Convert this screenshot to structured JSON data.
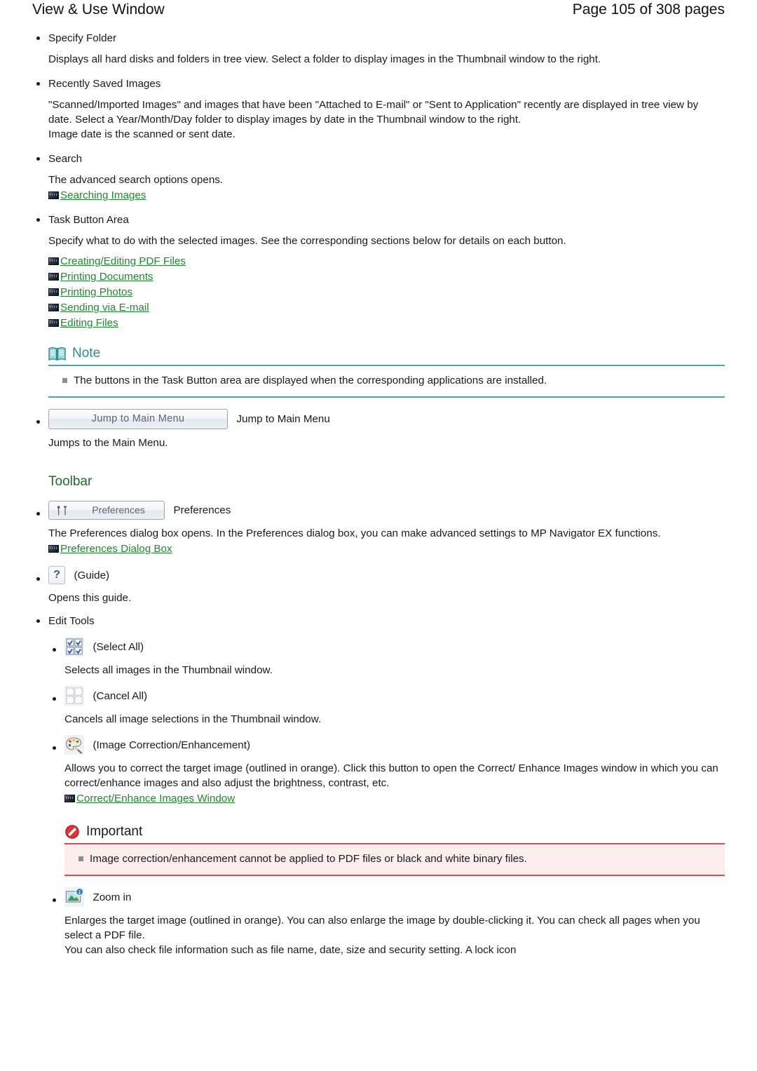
{
  "header": {
    "title": "View & Use Window",
    "page_count": "Page 105 of 308 pages"
  },
  "sections": {
    "specify_folder": {
      "label": "Specify Folder",
      "body": "Displays all hard disks and folders in tree view. Select a folder to display images in the Thumbnail window to the right."
    },
    "recently_saved": {
      "label": "Recently Saved Images",
      "body": "\"Scanned/Imported Images\" and images that have been \"Attached to E-mail\" or \"Sent to Application\" recently are displayed in tree view by date. Select a Year/Month/Day folder to display images by date in the Thumbnail window to the right.",
      "body2": "Image date is the scanned or sent date."
    },
    "search": {
      "label": "Search",
      "body": "The advanced search options opens.",
      "link": "Searching Images"
    },
    "task_button_area": {
      "label": "Task Button Area",
      "body": "Specify what to do with the selected images. See the corresponding sections below for details on each button.",
      "links": [
        "Creating/Editing PDF Files",
        "Printing Documents",
        "Printing Photos",
        "Sending via E-mail",
        "Editing Files"
      ]
    },
    "note": {
      "title": "Note",
      "items": [
        "The buttons in the Task Button area are displayed when the corresponding applications are installed."
      ]
    },
    "jump_to_main_menu": {
      "button_label": "Jump to Main Menu",
      "caption": "Jump to Main Menu",
      "body": "Jumps to the Main Menu."
    },
    "toolbar": {
      "heading": "Toolbar",
      "preferences": {
        "button_label": "Preferences",
        "caption": "Preferences",
        "body": "The Preferences dialog box opens. In the Preferences dialog box, you can make advanced settings to MP Navigator EX functions.",
        "link": "Preferences Dialog Box"
      },
      "guide": {
        "caption": "(Guide)",
        "body": "Opens this guide."
      },
      "edit_tools": {
        "label": "Edit Tools",
        "select_all": {
          "caption": "(Select All)",
          "body": "Selects all images in the Thumbnail window."
        },
        "cancel_all": {
          "caption": "(Cancel All)",
          "body": "Cancels all image selections in the Thumbnail window."
        },
        "image_correction": {
          "caption": "(Image Correction/Enhancement)",
          "body": "Allows you to correct the target image (outlined in orange). Click this button to open the Correct/ Enhance Images window in which you can correct/enhance images and also adjust the brightness, contrast, etc.",
          "link": "Correct/Enhance Images Window"
        },
        "important": {
          "title": "Important",
          "items": [
            "Image correction/enhancement cannot be applied to PDF files or black and white binary files."
          ]
        },
        "zoom_in": {
          "caption": "Zoom in",
          "body": "Enlarges the target image (outlined in orange). You can also enlarge the image by double-clicking it. You can check all pages when you select a PDF file.",
          "body2": "You can also check file information such as file name, date, size and security setting. A lock icon"
        }
      }
    }
  },
  "colors": {
    "link_green": "#1f8a2e",
    "heading_green": "#236b28",
    "note_teal": "#2a8c8c",
    "important_red": "#e04a4a"
  }
}
